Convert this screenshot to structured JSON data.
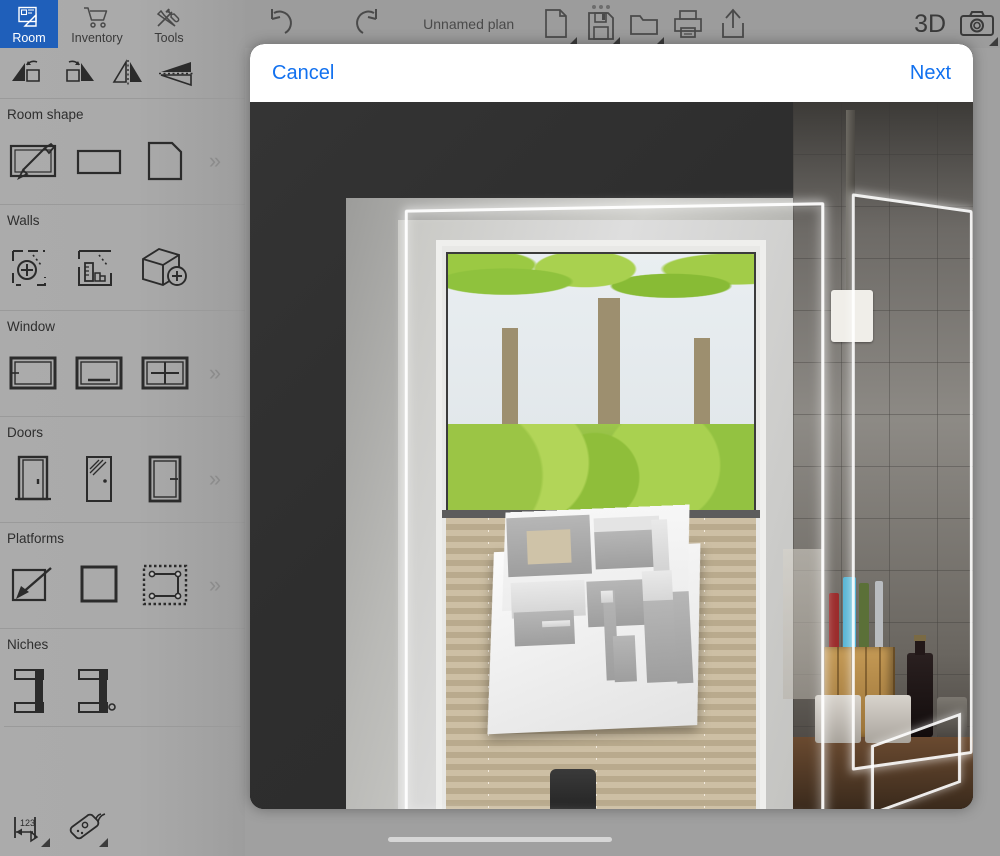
{
  "app": {
    "tabs": [
      {
        "id": "room",
        "label": "Room",
        "icon": "room-plan-icon",
        "active": true
      },
      {
        "id": "inventory",
        "label": "Inventory",
        "icon": "shopping-cart-icon",
        "active": false
      },
      {
        "id": "tools",
        "label": "Tools",
        "icon": "hammer-wrench-icon",
        "active": false
      }
    ],
    "accent_color": "#1f5fba",
    "link_color": "#1271ef",
    "panel_color": "#aaaaaa"
  },
  "transform_tools": [
    {
      "name": "rotate-left-icon",
      "label": "Rotate left"
    },
    {
      "name": "rotate-right-icon",
      "label": "Rotate right"
    },
    {
      "name": "mirror-vertical-icon",
      "label": "Mirror vertical"
    },
    {
      "name": "mirror-horizontal-icon",
      "label": "Mirror horizontal"
    }
  ],
  "sections": [
    {
      "id": "room-shape",
      "title": "Room shape",
      "has_more": true,
      "more_label": "»",
      "items": [
        {
          "name": "draw-room-icon",
          "label": "Draw room",
          "selected": true
        },
        {
          "name": "rectangular-room-icon",
          "label": "Rectangular room",
          "selected": false
        },
        {
          "name": "l-shaped-room-icon",
          "label": "L-shaped room",
          "selected": false
        }
      ]
    },
    {
      "id": "walls",
      "title": "Walls",
      "has_more": false,
      "more_label": "",
      "items": [
        {
          "name": "add-wall-icon",
          "label": "Add wall",
          "selected": false
        },
        {
          "name": "measure-wall-icon",
          "label": "Measure wall",
          "selected": false
        },
        {
          "name": "add-wall-block-icon",
          "label": "Add wall block",
          "selected": false
        }
      ]
    },
    {
      "id": "window",
      "title": "Window",
      "has_more": true,
      "more_label": "»",
      "items": [
        {
          "name": "window-plain-icon",
          "label": "Window",
          "selected": false
        },
        {
          "name": "window-sill-icon",
          "label": "Window with sill",
          "selected": false
        },
        {
          "name": "window-cross-icon",
          "label": "Cross window",
          "selected": false
        }
      ]
    },
    {
      "id": "doors",
      "title": "Doors",
      "has_more": true,
      "more_label": "»",
      "items": [
        {
          "name": "door-single-icon",
          "label": "Single door",
          "selected": false
        },
        {
          "name": "door-glass-icon",
          "label": "Glass door",
          "selected": false
        },
        {
          "name": "door-sliding-icon",
          "label": "Sliding door",
          "selected": false
        }
      ]
    },
    {
      "id": "platforms",
      "title": "Platforms",
      "has_more": true,
      "more_label": "»",
      "items": [
        {
          "name": "draw-platform-icon",
          "label": "Draw platform",
          "selected": false
        },
        {
          "name": "rectangular-platform-icon",
          "label": "Rectangular platform",
          "selected": false
        },
        {
          "name": "dashed-platform-icon",
          "label": "Custom platform",
          "selected": false
        }
      ]
    },
    {
      "id": "niches",
      "title": "Niches",
      "has_more": false,
      "more_label": "",
      "items": [
        {
          "name": "niche-square-icon",
          "label": "Square niche",
          "selected": false
        },
        {
          "name": "niche-round-icon",
          "label": "Round niche",
          "selected": false
        }
      ]
    }
  ],
  "bottom_tools": [
    {
      "name": "measurements-icon",
      "label": "Measurements"
    },
    {
      "name": "laser-measure-icon",
      "label": "Laser measure"
    }
  ],
  "toolbar": {
    "undo": {
      "name": "undo-icon",
      "label": "Undo"
    },
    "redo": {
      "name": "redo-icon",
      "label": "Redo"
    },
    "plan_title": "Unnamed plan",
    "new_plan": {
      "name": "new-document-icon",
      "label": "New plan"
    },
    "save": {
      "name": "save-floppy-icon",
      "label": "Save"
    },
    "open": {
      "name": "open-folder-icon",
      "label": "Open"
    },
    "print": {
      "name": "print-icon",
      "label": "Print"
    },
    "share": {
      "name": "share-icon",
      "label": "Share"
    },
    "view_3d": {
      "name": "3d-toggle",
      "label": "3D"
    },
    "camera": {
      "name": "camera-icon",
      "label": "Camera"
    }
  },
  "modal": {
    "cancel_label": "Cancel",
    "next_label": "Next",
    "view": "ar-camera-capture",
    "overlay": "3d-room-model"
  }
}
